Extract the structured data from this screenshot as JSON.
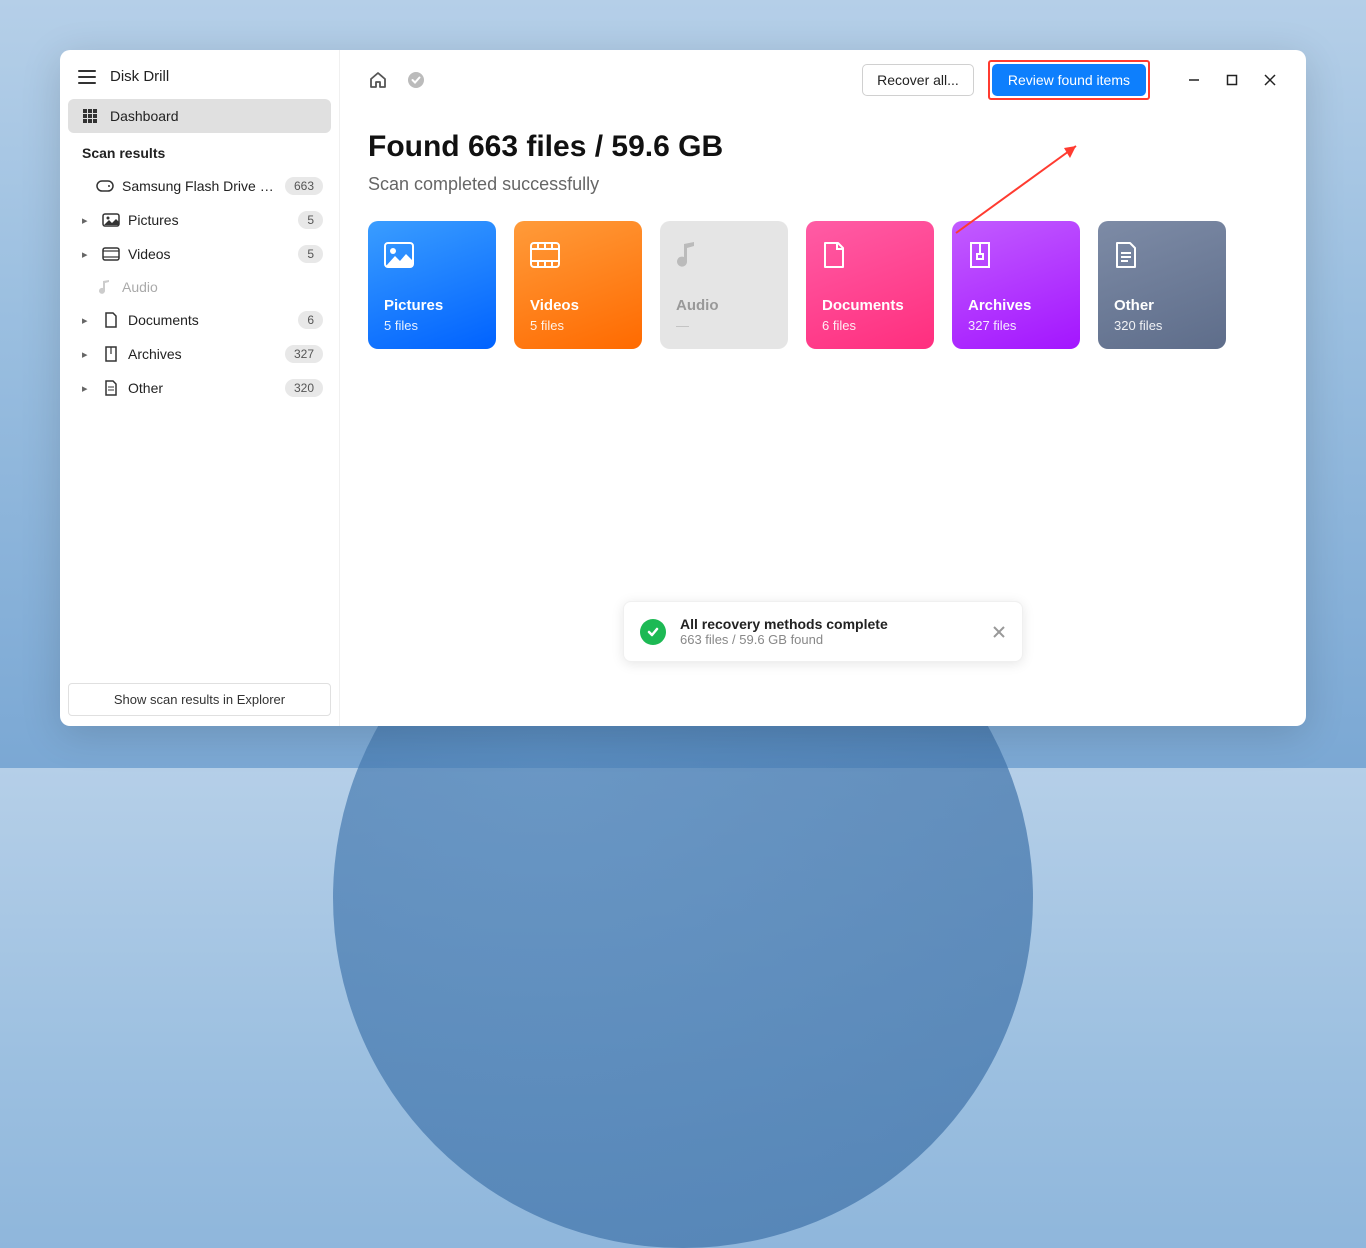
{
  "app": {
    "title": "Disk Drill"
  },
  "sidebar": {
    "dashboard": "Dashboard",
    "section": "Scan results",
    "drive": {
      "label": "Samsung Flash Drive US...",
      "count": "663"
    },
    "cats": {
      "pictures": {
        "label": "Pictures",
        "count": "5"
      },
      "videos": {
        "label": "Videos",
        "count": "5"
      },
      "audio": {
        "label": "Audio"
      },
      "documents": {
        "label": "Documents",
        "count": "6"
      },
      "archives": {
        "label": "Archives",
        "count": "327"
      },
      "other": {
        "label": "Other",
        "count": "320"
      }
    },
    "footer_btn": "Show scan results in Explorer"
  },
  "topbar": {
    "recover": "Recover all...",
    "review": "Review found items"
  },
  "main": {
    "headline": "Found 663 files / 59.6 GB",
    "subhead": "Scan completed successfully"
  },
  "cards": {
    "pictures": {
      "title": "Pictures",
      "sub": "5 files"
    },
    "videos": {
      "title": "Videos",
      "sub": "5 files"
    },
    "audio": {
      "title": "Audio",
      "sub": "—"
    },
    "documents": {
      "title": "Documents",
      "sub": "6 files"
    },
    "archives": {
      "title": "Archives",
      "sub": "327 files"
    },
    "other": {
      "title": "Other",
      "sub": "320 files"
    }
  },
  "toast": {
    "title": "All recovery methods complete",
    "sub": "663 files / 59.6 GB found"
  }
}
